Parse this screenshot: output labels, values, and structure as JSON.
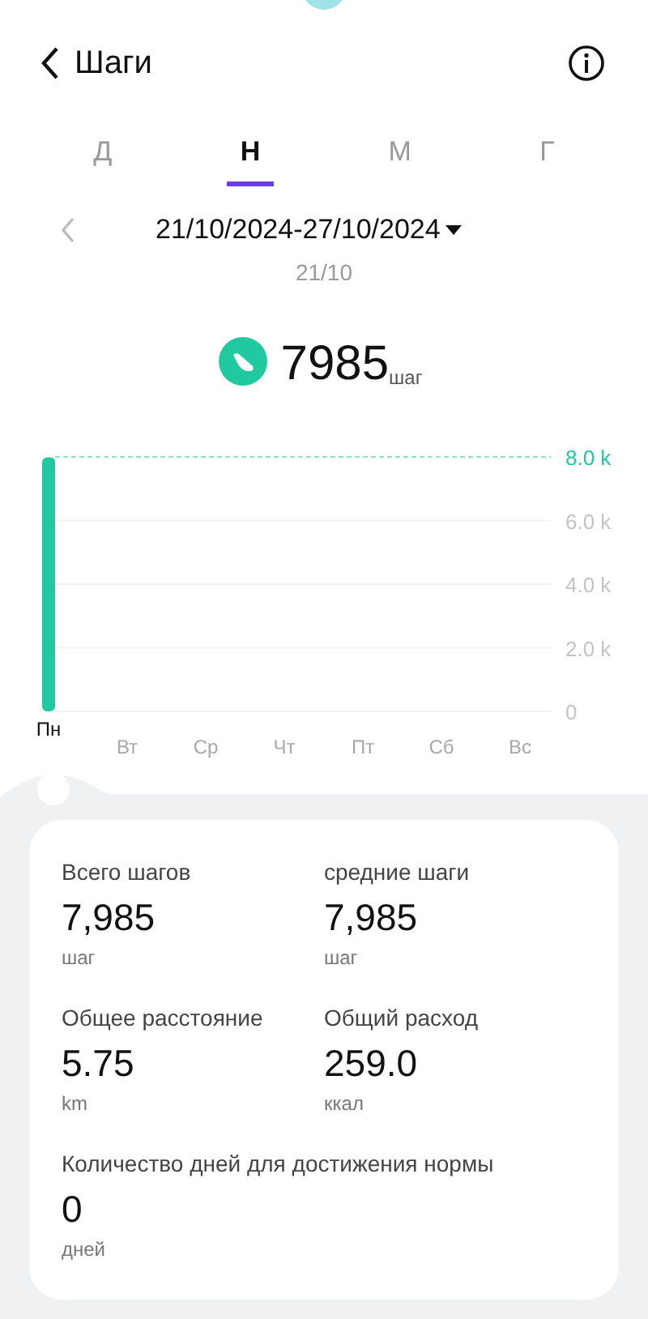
{
  "header": {
    "title": "Шаги"
  },
  "tabs": [
    {
      "label": "Д",
      "selected": false
    },
    {
      "label": "Н",
      "selected": true
    },
    {
      "label": "М",
      "selected": false
    },
    {
      "label": "Г",
      "selected": false
    }
  ],
  "period": {
    "range": "21/10/2024-27/10/2024",
    "selected_date": "21/10"
  },
  "summary": {
    "value": "7985",
    "unit": "шаг"
  },
  "chart": {
    "chart_data": {
      "type": "bar",
      "categories": [
        "Пн",
        "Вт",
        "Ср",
        "Чт",
        "Пт",
        "Сб",
        "Вс"
      ],
      "values": [
        7985,
        0,
        0,
        0,
        0,
        0,
        0
      ],
      "ylim": [
        0,
        8000
      ],
      "yticks": [
        {
          "value": 0,
          "label": "0"
        },
        {
          "value": 2000,
          "label": "2.0 k"
        },
        {
          "value": 4000,
          "label": "4.0 k"
        },
        {
          "value": 6000,
          "label": "6.0 k"
        },
        {
          "value": 8000,
          "label": "8.0 k"
        }
      ],
      "grid": true
    },
    "days": [
      {
        "selected": true
      },
      {
        "selected": false
      },
      {
        "selected": false
      },
      {
        "selected": false
      },
      {
        "selected": false
      },
      {
        "selected": false
      },
      {
        "selected": false
      }
    ]
  },
  "stats": [
    {
      "label": "Всего шагов",
      "value": "7,985",
      "unit": "шаг",
      "kind": "half"
    },
    {
      "label": "средние шаги",
      "value": "7,985",
      "unit": "шаг",
      "kind": "half"
    },
    {
      "label": "Общее расстояние",
      "value": "5.75",
      "unit": "km",
      "kind": "half"
    },
    {
      "label": "Общий расход",
      "value": "259.0",
      "unit": "ккал",
      "kind": "half"
    },
    {
      "label": "Количество дней для достижения нормы",
      "value": "0",
      "unit": "дней",
      "kind": "wide"
    }
  ]
}
